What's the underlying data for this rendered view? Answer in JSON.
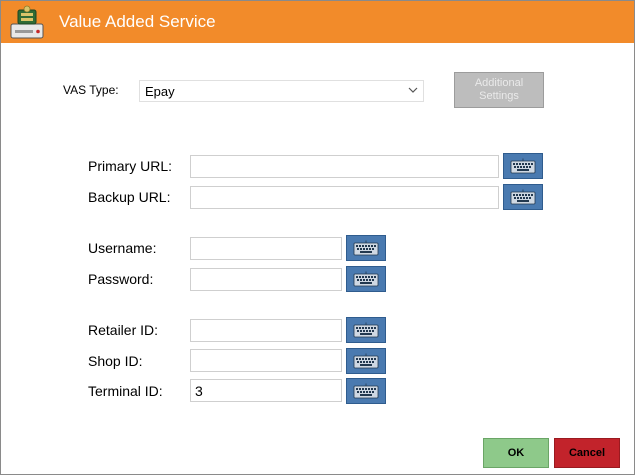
{
  "window": {
    "title": "Value Added Service"
  },
  "vas": {
    "type_label": "VAS Type:",
    "selected": "Epay",
    "additional_settings_label": "Additional Settings"
  },
  "fields": {
    "primary_url": {
      "label": "Primary URL:",
      "value": ""
    },
    "backup_url": {
      "label": "Backup URL:",
      "value": ""
    },
    "username": {
      "label": "Username:",
      "value": ""
    },
    "password": {
      "label": "Password:",
      "value": ""
    },
    "retailer_id": {
      "label": "Retailer ID:",
      "value": ""
    },
    "shop_id": {
      "label": "Shop ID:",
      "value": ""
    },
    "terminal_id": {
      "label": "Terminal ID:",
      "value": "3"
    }
  },
  "buttons": {
    "ok": "OK",
    "cancel": "Cancel"
  },
  "icons": {
    "app": "cash-drawer-icon",
    "keyboard": "keyboard-icon",
    "dropdown": "chevron-down-icon"
  },
  "colors": {
    "titlebar": "#f28b2a",
    "keyboard_button": "#4a7ab0",
    "ok": "#8ec98a",
    "cancel": "#c2232b",
    "disabled": "#bdbdbd"
  }
}
